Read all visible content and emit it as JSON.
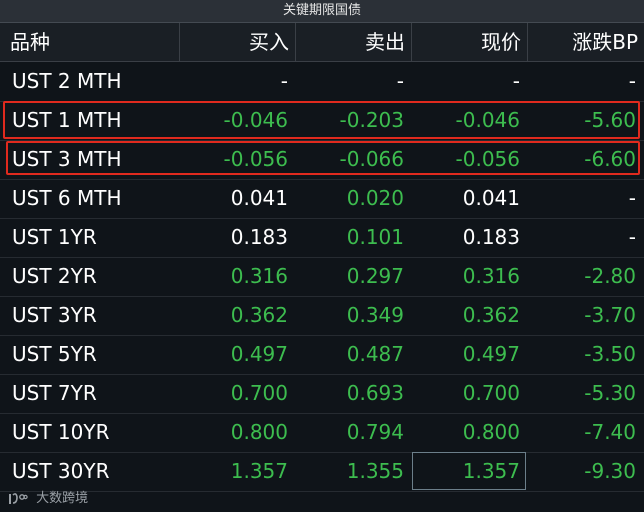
{
  "window": {
    "title": "关键期限国债"
  },
  "columns": {
    "name": "品种",
    "bid": "买入",
    "ask": "卖出",
    "last": "现价",
    "change_bp": "涨跌BP"
  },
  "rows": [
    {
      "name": "UST 2 MTH",
      "bid": "-",
      "ask": "-",
      "last": "-",
      "change_bp": "-",
      "bid_color": "white",
      "ask_color": "white",
      "last_color": "white",
      "chg_color": "white"
    },
    {
      "name": "UST 1 MTH",
      "bid": "-0.046",
      "ask": "-0.203",
      "last": "-0.046",
      "change_bp": "-5.60",
      "bid_color": "green",
      "ask_color": "green",
      "last_color": "green",
      "chg_color": "green"
    },
    {
      "name": "UST 3 MTH",
      "bid": "-0.056",
      "ask": "-0.066",
      "last": "-0.056",
      "change_bp": "-6.60",
      "bid_color": "green",
      "ask_color": "green",
      "last_color": "green",
      "chg_color": "green"
    },
    {
      "name": "UST 6 MTH",
      "bid": "0.041",
      "ask": "0.020",
      "last": "0.041",
      "change_bp": "-",
      "bid_color": "white",
      "ask_color": "green",
      "last_color": "white",
      "chg_color": "white"
    },
    {
      "name": "UST 1YR",
      "bid": "0.183",
      "ask": "0.101",
      "last": "0.183",
      "change_bp": "-",
      "bid_color": "white",
      "ask_color": "green",
      "last_color": "white",
      "chg_color": "white"
    },
    {
      "name": "UST 2YR",
      "bid": "0.316",
      "ask": "0.297",
      "last": "0.316",
      "change_bp": "-2.80",
      "bid_color": "green",
      "ask_color": "green",
      "last_color": "green",
      "chg_color": "green"
    },
    {
      "name": "UST 3YR",
      "bid": "0.362",
      "ask": "0.349",
      "last": "0.362",
      "change_bp": "-3.70",
      "bid_color": "green",
      "ask_color": "green",
      "last_color": "green",
      "chg_color": "green"
    },
    {
      "name": "UST 5YR",
      "bid": "0.497",
      "ask": "0.487",
      "last": "0.497",
      "change_bp": "-3.50",
      "bid_color": "green",
      "ask_color": "green",
      "last_color": "green",
      "chg_color": "green"
    },
    {
      "name": "UST 7YR",
      "bid": "0.700",
      "ask": "0.693",
      "last": "0.700",
      "change_bp": "-5.30",
      "bid_color": "green",
      "ask_color": "green",
      "last_color": "green",
      "chg_color": "green"
    },
    {
      "name": "UST 10YR",
      "bid": "0.800",
      "ask": "0.794",
      "last": "0.800",
      "change_bp": "-7.40",
      "bid_color": "green",
      "ask_color": "green",
      "last_color": "green",
      "chg_color": "green"
    },
    {
      "name": "UST 30YR",
      "bid": "1.357",
      "ask": "1.355",
      "last": "1.357",
      "change_bp": "-9.30",
      "bid_color": "green",
      "ask_color": "green",
      "last_color": "green",
      "chg_color": "green"
    }
  ],
  "highlighted_rows": [
    "UST 1 MTH",
    "UST 3 MTH"
  ],
  "selected_cell": {
    "row": "UST 30YR",
    "column": "现价"
  },
  "watermark": {
    "text": "大数跨境",
    "icon": "logo-icon"
  },
  "colors": {
    "down_green": "#3dbd4f",
    "neutral_white": "#ffffff",
    "highlight_red": "#e02a1e",
    "background": "#0f1419"
  }
}
